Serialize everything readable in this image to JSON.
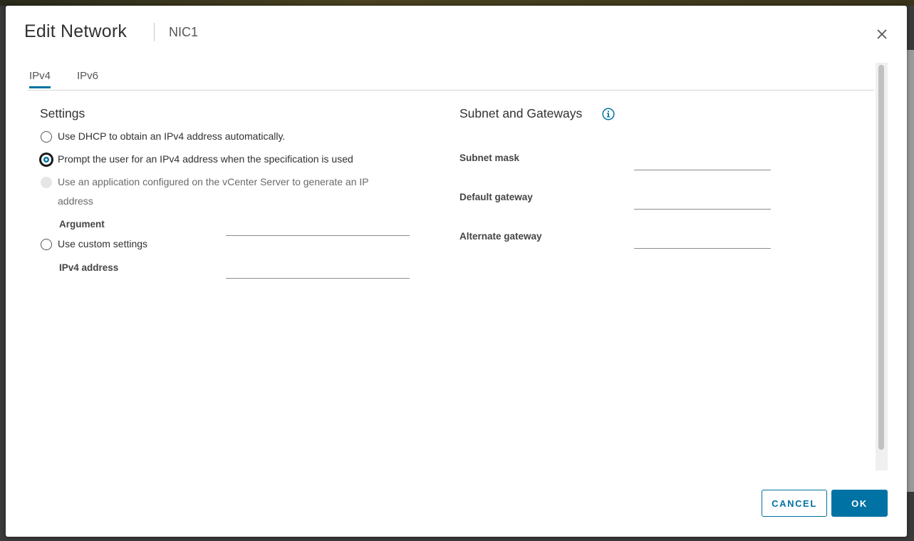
{
  "dialog": {
    "title": "Edit Network",
    "subtitle": "NIC1"
  },
  "tabs": [
    {
      "label": "IPv4",
      "active": true
    },
    {
      "label": "IPv6",
      "active": false
    }
  ],
  "settings": {
    "title": "Settings",
    "options": [
      {
        "label": "Use DHCP to obtain an IPv4 address automatically.",
        "state": "unchecked"
      },
      {
        "label": "Prompt the user for an IPv4 address when the specification is used",
        "state": "checked"
      },
      {
        "label": "Use an application configured on the vCenter Server to generate an IP address",
        "state": "disabled"
      },
      {
        "label": "Use custom settings",
        "state": "unchecked"
      }
    ],
    "argument_label": "Argument",
    "argument_value": "",
    "ipv4_address_label": "IPv4 address",
    "ipv4_address_value": ""
  },
  "subnet": {
    "title": "Subnet and Gateways",
    "fields": [
      {
        "label": "Subnet mask",
        "value": ""
      },
      {
        "label": "Default gateway",
        "value": ""
      },
      {
        "label": "Alternate gateway",
        "value": ""
      }
    ]
  },
  "footer": {
    "cancel_label": "CANCEL",
    "ok_label": "OK"
  },
  "colors": {
    "accent": "#0072a3",
    "text": "#313131"
  },
  "icons": {
    "close": "close-icon",
    "info": "info-icon"
  }
}
